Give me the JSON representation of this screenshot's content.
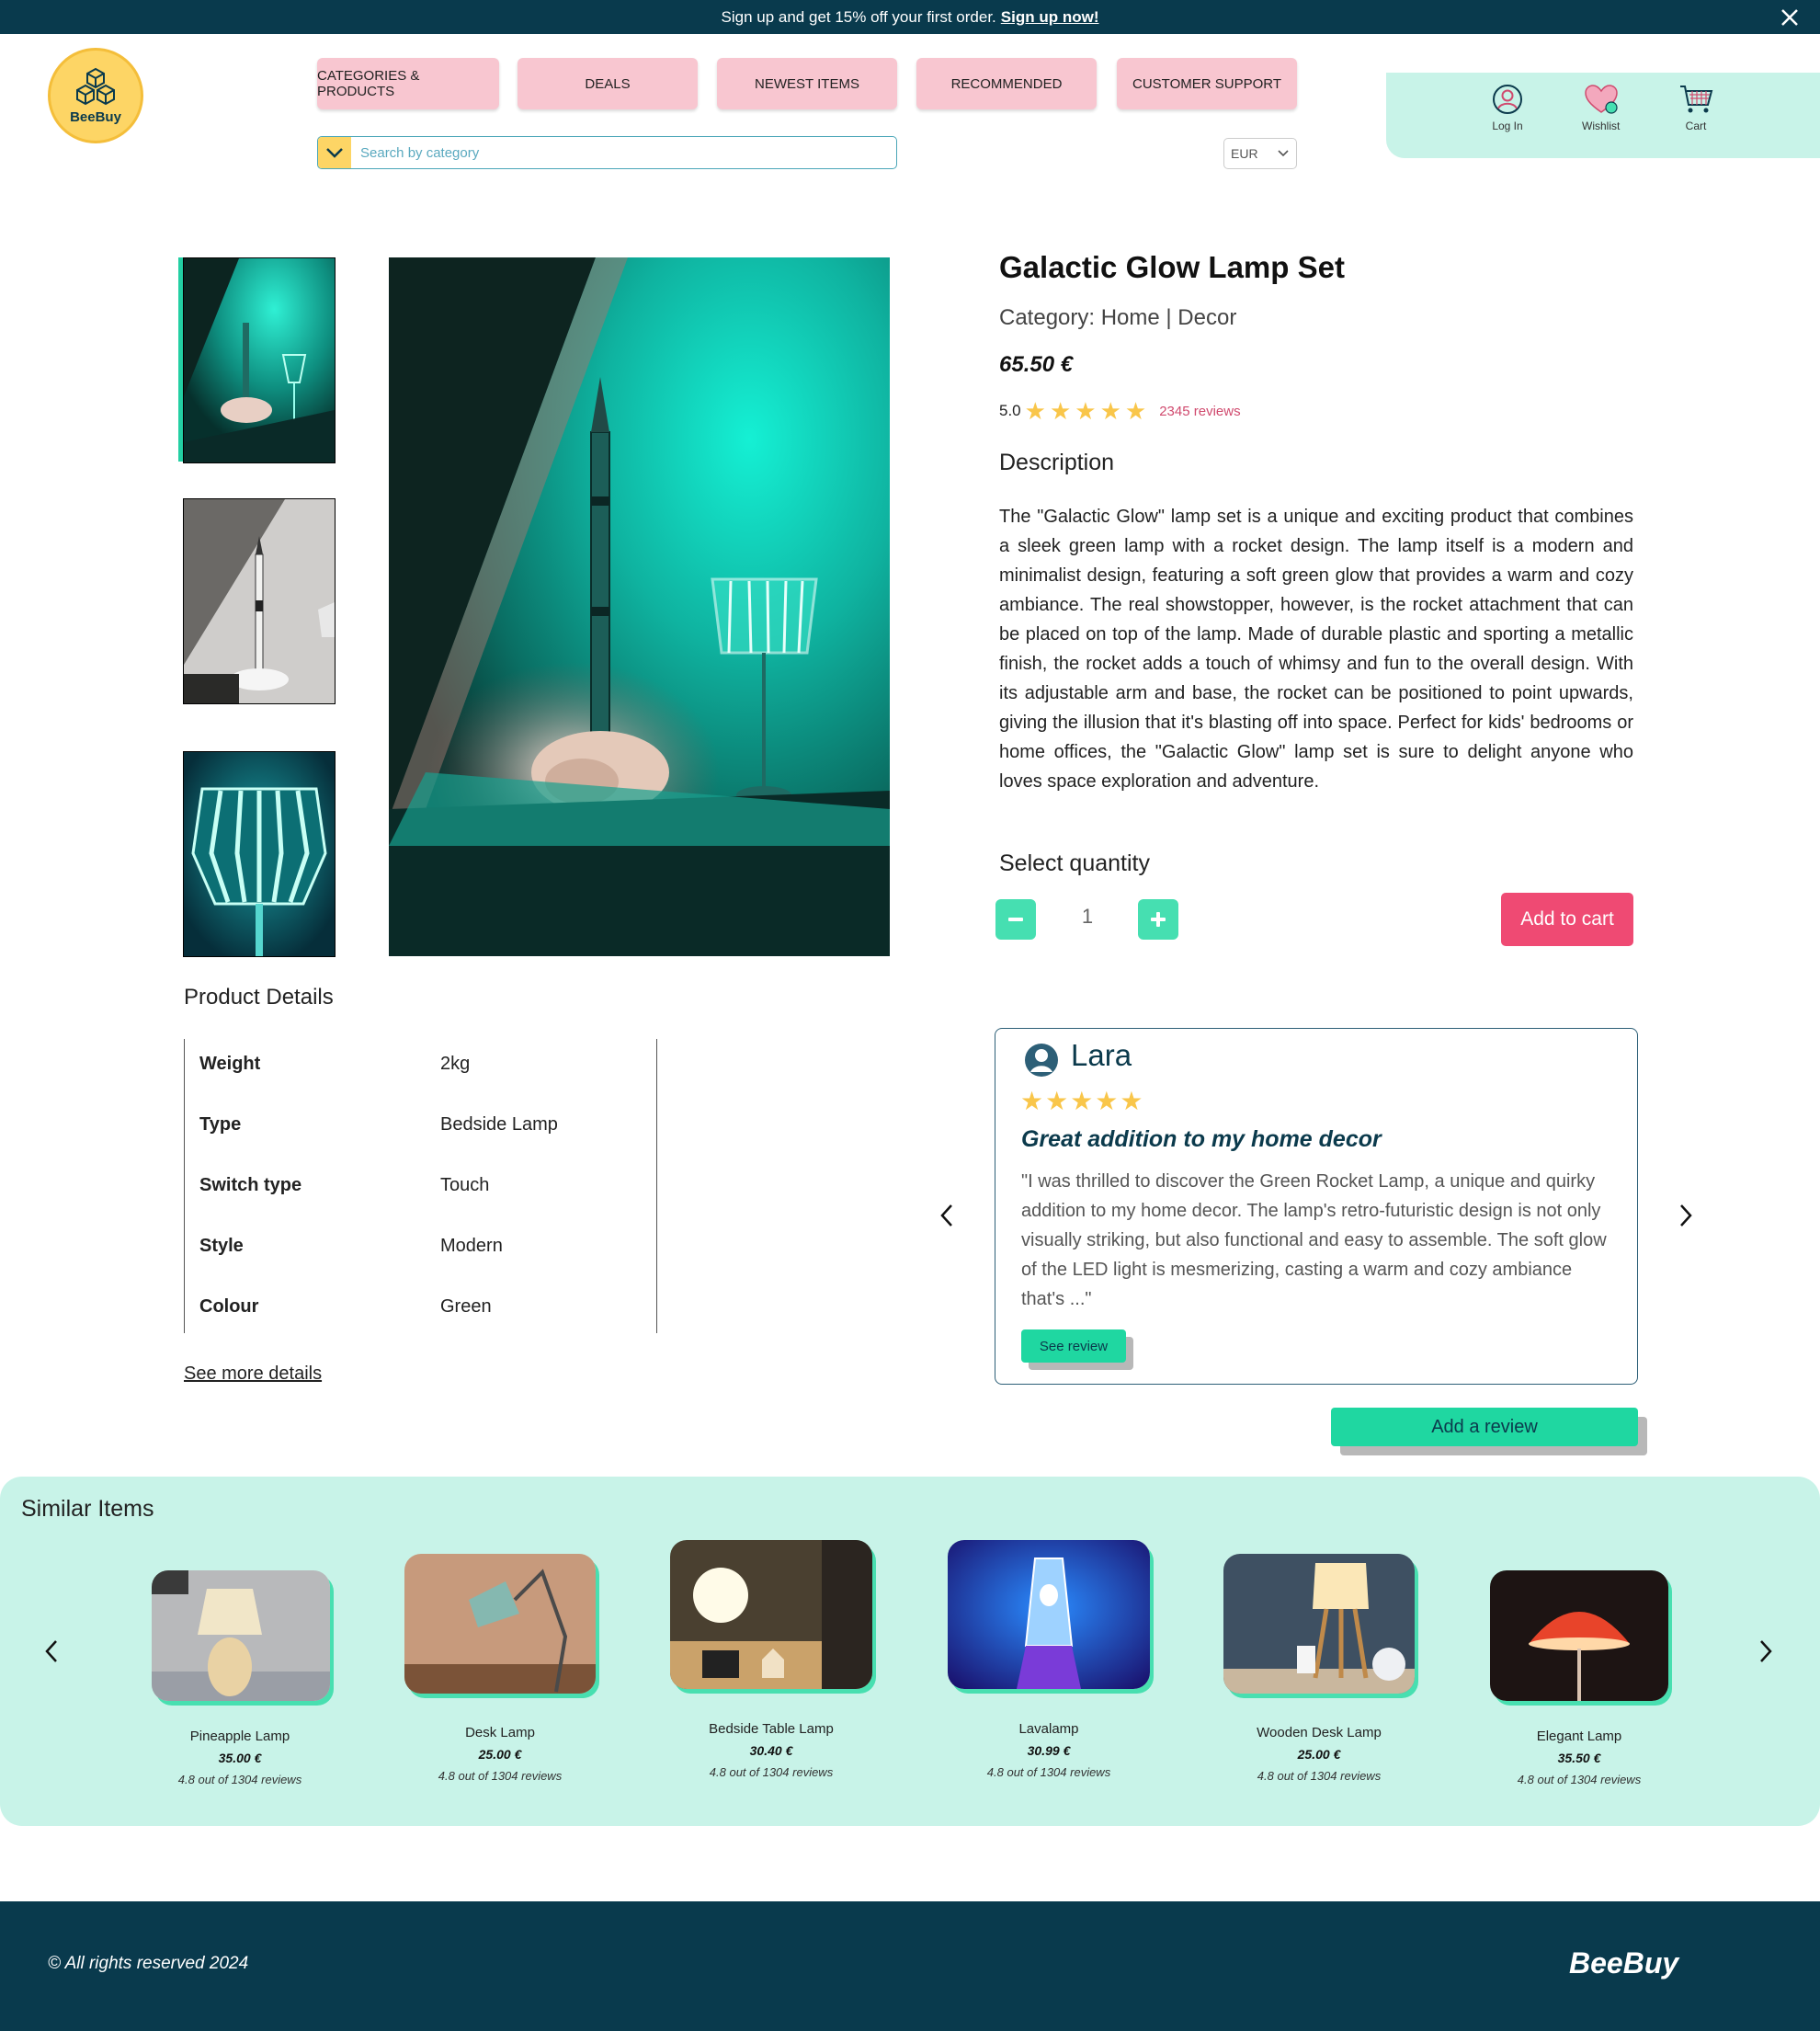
{
  "announcement": {
    "text": "Sign up and get 15% off your first order.",
    "link": "Sign up now!"
  },
  "brand": {
    "logo_text": "BeeBuy",
    "accent": "#fdd565",
    "dark": "#093a4d",
    "mint": "#c8f3e8",
    "pink": "#f8c6d0",
    "cta": "#ef4a73",
    "green": "#1fd7a1"
  },
  "nav": {
    "items": [
      "CATEGORIES & PRODUCTS",
      "DEALS",
      "NEWEST ITEMS",
      "RECOMMENDED",
      "CUSTOMER SUPPORT"
    ]
  },
  "search": {
    "placeholder": "Search by category"
  },
  "currency": {
    "selected": "EUR"
  },
  "account": {
    "login": "Log In",
    "wishlist": "Wishlist",
    "cart": "Cart"
  },
  "product": {
    "title": "Galactic Glow Lamp Set",
    "category": "Category: Home | Decor",
    "price": "65.50 €",
    "rating": "5.0",
    "stars": 5,
    "reviews": "2345 reviews",
    "description_heading": "Description",
    "description": "The \"Galactic Glow\" lamp set is a unique and exciting product that combines a sleek green lamp with a rocket design. The lamp itself is a modern and minimalist design, featuring a soft green glow that provides a warm and cozy ambiance. The real showstopper, however, is the rocket attachment that can be placed on top of the lamp. Made of durable plastic and sporting a metallic finish, the rocket adds a touch of whimsy and fun to the overall design. With its adjustable arm and base, the rocket can be positioned to point upwards, giving the illusion that it's blasting off into space. Perfect for kids' bedrooms or home offices, the \"Galactic Glow\" lamp set is sure to delight anyone who loves space exploration and adventure.",
    "quantity_heading": "Select quantity",
    "quantity": "1",
    "add_to_cart": "Add to cart"
  },
  "details": {
    "heading": "Product Details",
    "rows": [
      {
        "key": "Weight",
        "value": "2kg"
      },
      {
        "key": "Type",
        "value": "Bedside Lamp"
      },
      {
        "key": "Switch type",
        "value": "Touch"
      },
      {
        "key": "Style",
        "value": "Modern"
      },
      {
        "key": "Colour",
        "value": "Green"
      }
    ],
    "see_more": "See more details"
  },
  "review": {
    "name": "Lara",
    "stars": "★★★★★",
    "title": "Great addition to my home decor",
    "body": "\"I was thrilled to discover the Green Rocket Lamp, a unique and quirky addition to my home decor. The lamp's retro-futuristic design is not only visually striking, but also functional and easy to assemble. The soft glow of the LED light is mesmerizing, casting a warm and cozy ambiance that's ...\"",
    "button": "See review",
    "add_review": "Add a review"
  },
  "similar": {
    "heading": "Similar Items",
    "items": [
      {
        "name": "Pineapple Lamp",
        "price": "35.00 €",
        "reviews": "4.8 out of 1304 reviews"
      },
      {
        "name": "Desk Lamp",
        "price": "25.00 €",
        "reviews": "4.8 out of 1304 reviews"
      },
      {
        "name": "Bedside Table Lamp",
        "price": "30.40 €",
        "reviews": "4.8 out of 1304 reviews"
      },
      {
        "name": "Lavalamp",
        "price": "30.99 €",
        "reviews": "4.8 out of 1304 reviews"
      },
      {
        "name": "Wooden Desk Lamp",
        "price": "25.00 €",
        "reviews": "4.8 out of 1304 reviews"
      },
      {
        "name": "Elegant Lamp",
        "price": "35.50 €",
        "reviews": "4.8 out of 1304 reviews"
      }
    ]
  },
  "footer": {
    "copyright": "© All rights reserved 2024",
    "brand": "BeeBuy"
  }
}
